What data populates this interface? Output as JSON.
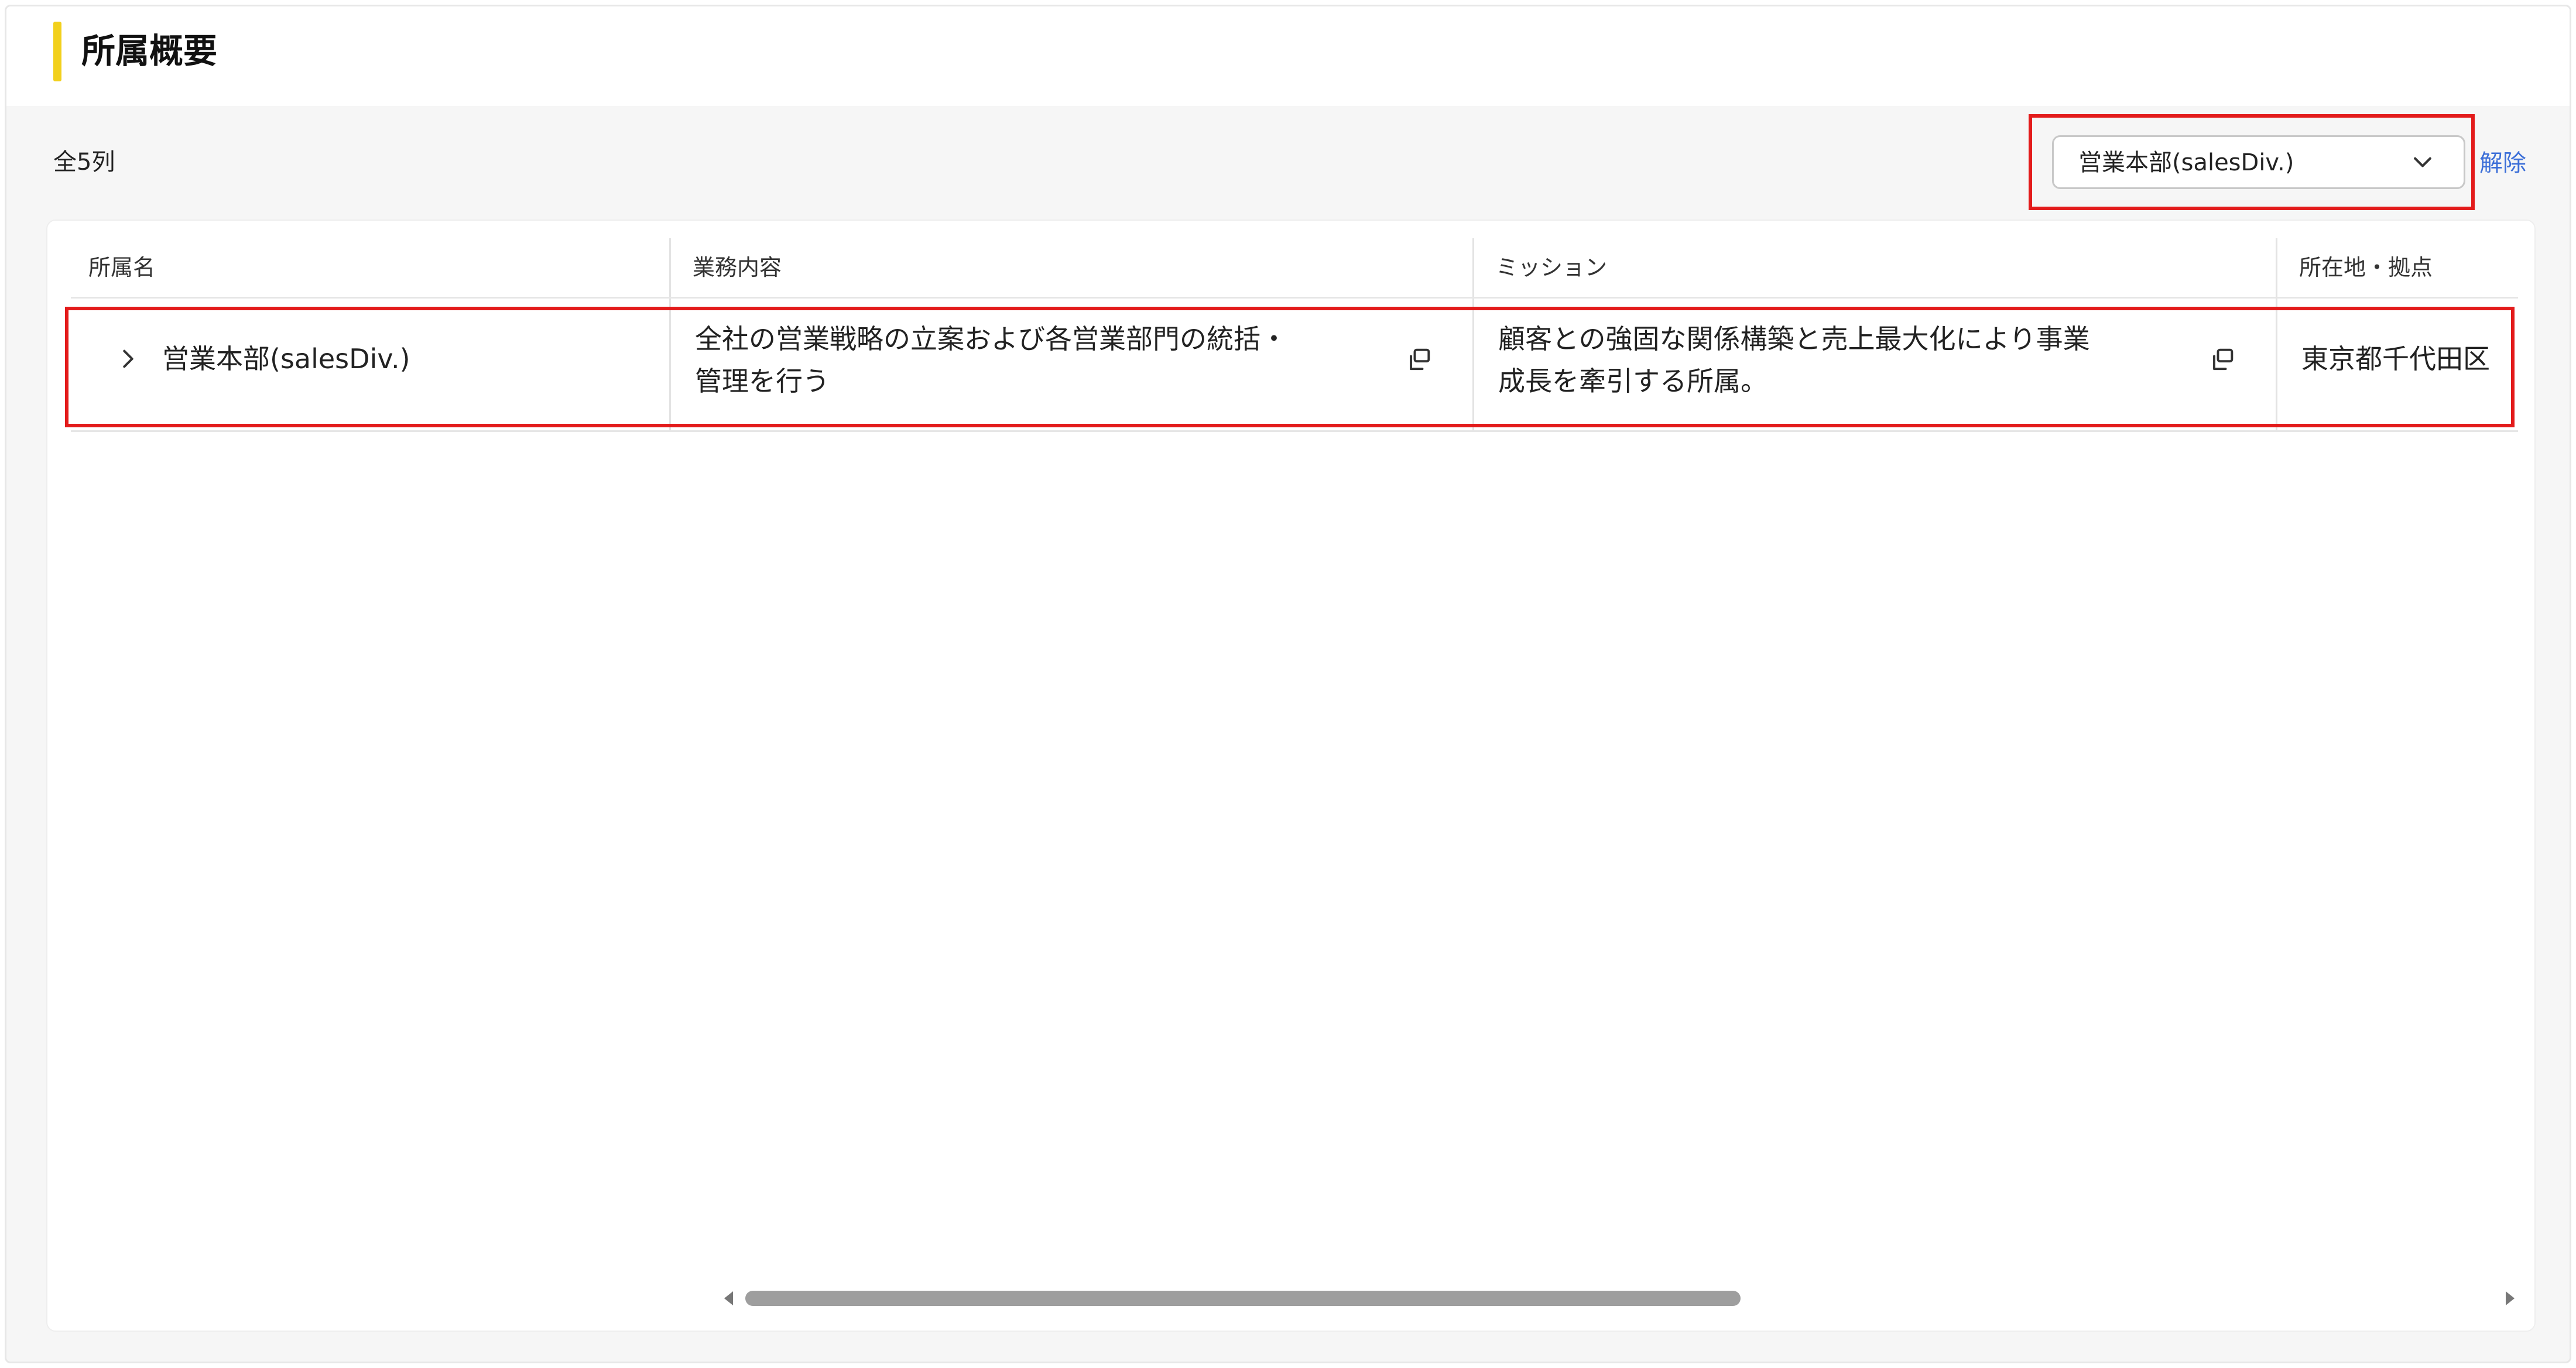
{
  "header": {
    "title": "所属概要"
  },
  "toolbar": {
    "count_label": "全5列",
    "filter_select": {
      "selected": "営業本部(salesDiv.)"
    },
    "clear_label": "解除"
  },
  "table": {
    "columns": [
      "所属名",
      "業務内容",
      "ミッション",
      "所在地・拠点"
    ],
    "rows": [
      {
        "name": "営業本部(salesDiv.)",
        "business_line1": "全社の営業戦略の立案および各営業部門の統括・",
        "business_line2": "管理を行う",
        "mission_line1": "顧客との強固な関係構築と売上最大化により事業",
        "mission_line2": "成長を牽引する所属。",
        "location": "東京都千代田区"
      }
    ]
  },
  "colors": {
    "accent": "#f2d01c",
    "highlight": "#e31b1b",
    "link": "#3c6fd8"
  }
}
